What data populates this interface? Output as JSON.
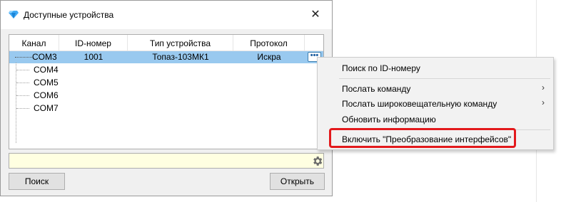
{
  "window": {
    "title": "Доступные устройства",
    "close": "✕"
  },
  "tree": {
    "columns": [
      "Канал",
      "ID-номер",
      "Тип устройства",
      "Протокол"
    ],
    "selected_row": {
      "channel": "COM3",
      "id": "1001",
      "device_type": "Топаз-103МК1",
      "protocol": "Искра",
      "dots": "•••"
    },
    "items": [
      "COM4",
      "COM5",
      "COM6",
      "COM7"
    ]
  },
  "filter": {
    "value": ""
  },
  "buttons": {
    "search": "Поиск",
    "open": "Открыть"
  },
  "context_menu": {
    "items": [
      "Поиск по ID-номеру",
      "Послать команду",
      "Послать широковещательную команду",
      "Обновить информацию",
      "Включить \"Преобразование интерфейсов\""
    ],
    "submenu_arrow": "›"
  },
  "colors": {
    "selection": "#99c9ef",
    "highlight_border": "#e3191c",
    "filter_bg": "#ffffe1"
  }
}
